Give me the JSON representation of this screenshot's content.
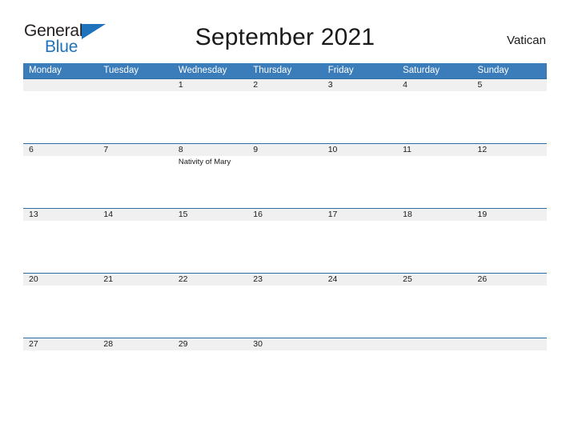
{
  "brand": {
    "name_top": "General",
    "name_bottom": "Blue",
    "triangle_color": "#1f73bd"
  },
  "header": {
    "title": "September 2021",
    "country": "Vatican"
  },
  "theme": {
    "header_blue": "#3b7cba",
    "rule_blue": "#2e6da4",
    "band_gray": "#f0f0f0",
    "text": "#1a1a1a"
  },
  "calendar": {
    "weekdays": [
      "Monday",
      "Tuesday",
      "Wednesday",
      "Thursday",
      "Friday",
      "Saturday",
      "Sunday"
    ],
    "weeks": [
      [
        {
          "day": "",
          "events": []
        },
        {
          "day": "",
          "events": []
        },
        {
          "day": "1",
          "events": []
        },
        {
          "day": "2",
          "events": []
        },
        {
          "day": "3",
          "events": []
        },
        {
          "day": "4",
          "events": []
        },
        {
          "day": "5",
          "events": []
        }
      ],
      [
        {
          "day": "6",
          "events": []
        },
        {
          "day": "7",
          "events": []
        },
        {
          "day": "8",
          "events": [
            "Nativity of Mary"
          ]
        },
        {
          "day": "9",
          "events": []
        },
        {
          "day": "10",
          "events": []
        },
        {
          "day": "11",
          "events": []
        },
        {
          "day": "12",
          "events": []
        }
      ],
      [
        {
          "day": "13",
          "events": []
        },
        {
          "day": "14",
          "events": []
        },
        {
          "day": "15",
          "events": []
        },
        {
          "day": "16",
          "events": []
        },
        {
          "day": "17",
          "events": []
        },
        {
          "day": "18",
          "events": []
        },
        {
          "day": "19",
          "events": []
        }
      ],
      [
        {
          "day": "20",
          "events": []
        },
        {
          "day": "21",
          "events": []
        },
        {
          "day": "22",
          "events": []
        },
        {
          "day": "23",
          "events": []
        },
        {
          "day": "24",
          "events": []
        },
        {
          "day": "25",
          "events": []
        },
        {
          "day": "26",
          "events": []
        }
      ],
      [
        {
          "day": "27",
          "events": []
        },
        {
          "day": "28",
          "events": []
        },
        {
          "day": "29",
          "events": []
        },
        {
          "day": "30",
          "events": []
        },
        {
          "day": "",
          "events": []
        },
        {
          "day": "",
          "events": []
        },
        {
          "day": "",
          "events": []
        }
      ]
    ]
  }
}
